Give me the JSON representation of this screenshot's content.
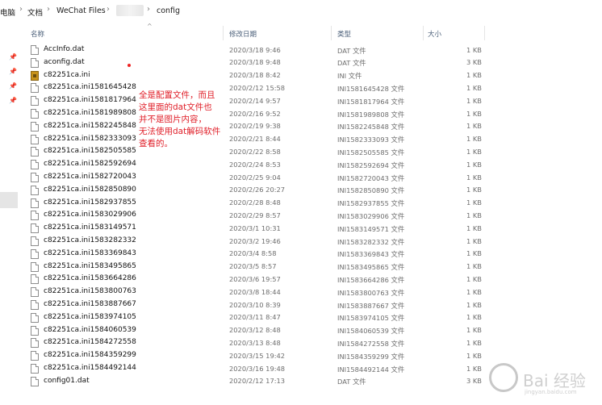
{
  "breadcrumb": {
    "segments": [
      "电脑",
      "文档",
      "WeChat Files",
      "config"
    ],
    "separator": "›"
  },
  "columns": {
    "name": "名称",
    "date": "修改日期",
    "type": "类型",
    "size": "大小"
  },
  "files": [
    {
      "name": "AccInfo.dat",
      "date": "2020/3/18 9:46",
      "type": "DAT 文件",
      "size": "1 KB",
      "icon": "dat-file-icon"
    },
    {
      "name": "aconfig.dat",
      "date": "2020/3/18 9:48",
      "type": "DAT 文件",
      "size": "3 KB",
      "icon": "dat-file-icon"
    },
    {
      "name": "c82251ca.ini",
      "date": "2020/3/18 8:42",
      "type": "INI 文件",
      "size": "1 KB",
      "icon": "ini-file-icon"
    },
    {
      "name": "c82251ca.ini1581645428",
      "date": "2020/2/12 15:58",
      "type": "INI1581645428 文件",
      "size": "1 KB",
      "icon": "generic-file-icon"
    },
    {
      "name": "c82251ca.ini1581817964",
      "date": "2020/2/14 9:57",
      "type": "INI1581817964 文件",
      "size": "1 KB",
      "icon": "generic-file-icon"
    },
    {
      "name": "c82251ca.ini1581989808",
      "date": "2020/2/16 9:52",
      "type": "INI1581989808 文件",
      "size": "1 KB",
      "icon": "generic-file-icon"
    },
    {
      "name": "c82251ca.ini1582245848",
      "date": "2020/2/19 9:38",
      "type": "INI1582245848 文件",
      "size": "1 KB",
      "icon": "generic-file-icon"
    },
    {
      "name": "c82251ca.ini1582333093",
      "date": "2020/2/21 8:44",
      "type": "INI1582333093 文件",
      "size": "1 KB",
      "icon": "generic-file-icon"
    },
    {
      "name": "c82251ca.ini1582505585",
      "date": "2020/2/22 8:58",
      "type": "INI1582505585 文件",
      "size": "1 KB",
      "icon": "generic-file-icon"
    },
    {
      "name": "c82251ca.ini1582592694",
      "date": "2020/2/24 8:53",
      "type": "INI1582592694 文件",
      "size": "1 KB",
      "icon": "generic-file-icon"
    },
    {
      "name": "c82251ca.ini1582720043",
      "date": "2020/2/25 9:04",
      "type": "INI1582720043 文件",
      "size": "1 KB",
      "icon": "generic-file-icon"
    },
    {
      "name": "c82251ca.ini1582850890",
      "date": "2020/2/26 20:27",
      "type": "INI1582850890 文件",
      "size": "1 KB",
      "icon": "generic-file-icon"
    },
    {
      "name": "c82251ca.ini1582937855",
      "date": "2020/2/28 8:48",
      "type": "INI1582937855 文件",
      "size": "1 KB",
      "icon": "generic-file-icon"
    },
    {
      "name": "c82251ca.ini1583029906",
      "date": "2020/2/29 8:57",
      "type": "INI1583029906 文件",
      "size": "1 KB",
      "icon": "generic-file-icon"
    },
    {
      "name": "c82251ca.ini1583149571",
      "date": "2020/3/1 10:31",
      "type": "INI1583149571 文件",
      "size": "1 KB",
      "icon": "generic-file-icon"
    },
    {
      "name": "c82251ca.ini1583282332",
      "date": "2020/3/2 19:46",
      "type": "INI1583282332 文件",
      "size": "1 KB",
      "icon": "generic-file-icon"
    },
    {
      "name": "c82251ca.ini1583369843",
      "date": "2020/3/4 8:58",
      "type": "INI1583369843 文件",
      "size": "1 KB",
      "icon": "generic-file-icon"
    },
    {
      "name": "c82251ca.ini1583495865",
      "date": "2020/3/5 8:57",
      "type": "INI1583495865 文件",
      "size": "1 KB",
      "icon": "generic-file-icon"
    },
    {
      "name": "c82251ca.ini1583664286",
      "date": "2020/3/6 19:57",
      "type": "INI1583664286 文件",
      "size": "1 KB",
      "icon": "generic-file-icon"
    },
    {
      "name": "c82251ca.ini1583800763",
      "date": "2020/3/8 18:44",
      "type": "INI1583800763 文件",
      "size": "1 KB",
      "icon": "generic-file-icon"
    },
    {
      "name": "c82251ca.ini1583887667",
      "date": "2020/3/10 8:39",
      "type": "INI1583887667 文件",
      "size": "1 KB",
      "icon": "generic-file-icon"
    },
    {
      "name": "c82251ca.ini1583974105",
      "date": "2020/3/11 8:47",
      "type": "INI1583974105 文件",
      "size": "1 KB",
      "icon": "generic-file-icon"
    },
    {
      "name": "c82251ca.ini1584060539",
      "date": "2020/3/12 8:48",
      "type": "INI1584060539 文件",
      "size": "1 KB",
      "icon": "generic-file-icon"
    },
    {
      "name": "c82251ca.ini1584272558",
      "date": "2020/3/13 8:48",
      "type": "INI1584272558 文件",
      "size": "1 KB",
      "icon": "generic-file-icon"
    },
    {
      "name": "c82251ca.ini1584359299",
      "date": "2020/3/15 19:42",
      "type": "INI1584359299 文件",
      "size": "1 KB",
      "icon": "generic-file-icon"
    },
    {
      "name": "c82251ca.ini1584492144",
      "date": "2020/3/16 19:48",
      "type": "INI1584492144 文件",
      "size": "1 KB",
      "icon": "generic-file-icon"
    },
    {
      "name": "config01.dat",
      "date": "2020/2/12 17:13",
      "type": "DAT 文件",
      "size": "3 KB",
      "icon": "dat-file-icon"
    }
  ],
  "annotation": {
    "lines": [
      "全是配置文件，而且",
      "这里面的dat文件也",
      "并不是图片内容，",
      "无法使用dat解码软件",
      "查看的。"
    ],
    "color": "#e0202a"
  },
  "watermark": {
    "text": "Bai 经验",
    "sub": "jingyan.baidu.com"
  },
  "colors": {
    "header_text": "#4c607a",
    "meta_text": "#6d6d6d",
    "ini_icon": "#c8931c"
  }
}
